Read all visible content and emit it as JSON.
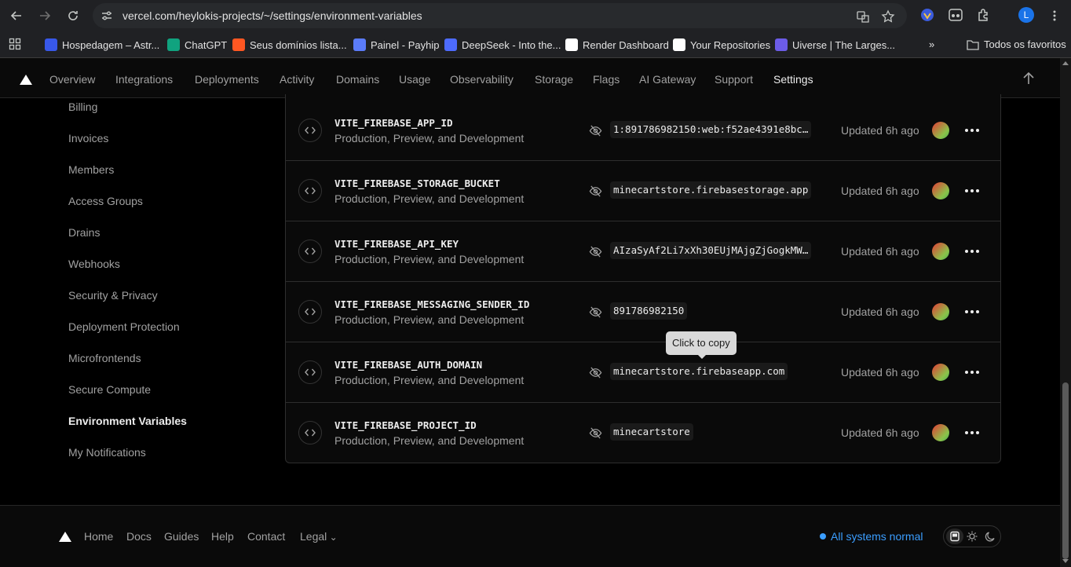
{
  "browser": {
    "url": "vercel.com/heylokis-projects/~/settings/environment-variables",
    "profile_initial": "L",
    "bookmarks": [
      {
        "label": "Hospedagem – Astr...",
        "color": "#3858e9"
      },
      {
        "label": "ChatGPT",
        "color": "#10a37f"
      },
      {
        "label": "Seus domínios lista...",
        "color": "#ff5722"
      },
      {
        "label": "Painel - Payhip",
        "color": "#5b7cfa"
      },
      {
        "label": "DeepSeek - Into the...",
        "color": "#4d6bfe"
      },
      {
        "label": "Render Dashboard",
        "color": "#ffffff"
      },
      {
        "label": "Your Repositories",
        "color": "#ffffff"
      },
      {
        "label": "Uiverse | The Larges...",
        "color": "#6c5ce7"
      }
    ],
    "all_bookmarks_label": "Todos os favoritos"
  },
  "nav": {
    "items": [
      "Overview",
      "Integrations",
      "Deployments",
      "Activity",
      "Domains",
      "Usage",
      "Observability",
      "Storage",
      "Flags",
      "AI Gateway",
      "Support",
      "Settings"
    ],
    "active": "Settings"
  },
  "sidebar": {
    "items": [
      "Billing",
      "Invoices",
      "Members",
      "Access Groups",
      "Drains",
      "Webhooks",
      "Security & Privacy",
      "Deployment Protection",
      "Microfrontends",
      "Secure Compute",
      "Environment Variables",
      "My Notifications"
    ],
    "active": "Environment Variables"
  },
  "env_vars": [
    {
      "name": "VITE_FIREBASE_APP_ID",
      "targets": "Production, Preview, and Development",
      "value": "1:891786982150:web:f52ae4391e8bc…",
      "updated": "Updated 6h ago"
    },
    {
      "name": "VITE_FIREBASE_STORAGE_BUCKET",
      "targets": "Production, Preview, and Development",
      "value": "minecartstore.firebasestorage.app",
      "updated": "Updated 6h ago"
    },
    {
      "name": "VITE_FIREBASE_API_KEY",
      "targets": "Production, Preview, and Development",
      "value": "AIzaSyAf2Li7xXh30EUjMAjgZjGogkMW…",
      "updated": "Updated 6h ago"
    },
    {
      "name": "VITE_FIREBASE_MESSAGING_SENDER_ID",
      "targets": "Production, Preview, and Development",
      "value": "891786982150",
      "updated": "Updated 6h ago"
    },
    {
      "name": "VITE_FIREBASE_AUTH_DOMAIN",
      "targets": "Production, Preview, and Development",
      "value": "minecartstore.firebaseapp.com",
      "updated": "Updated 6h ago"
    },
    {
      "name": "VITE_FIREBASE_PROJECT_ID",
      "targets": "Production, Preview, and Development",
      "value": "minecartstore",
      "updated": "Updated 6h ago"
    }
  ],
  "tooltip": "Click to copy",
  "footer": {
    "links": [
      "Home",
      "Docs",
      "Guides",
      "Help",
      "Contact",
      "Legal"
    ],
    "status": "All systems normal",
    "status_color": "#3b9eff"
  }
}
